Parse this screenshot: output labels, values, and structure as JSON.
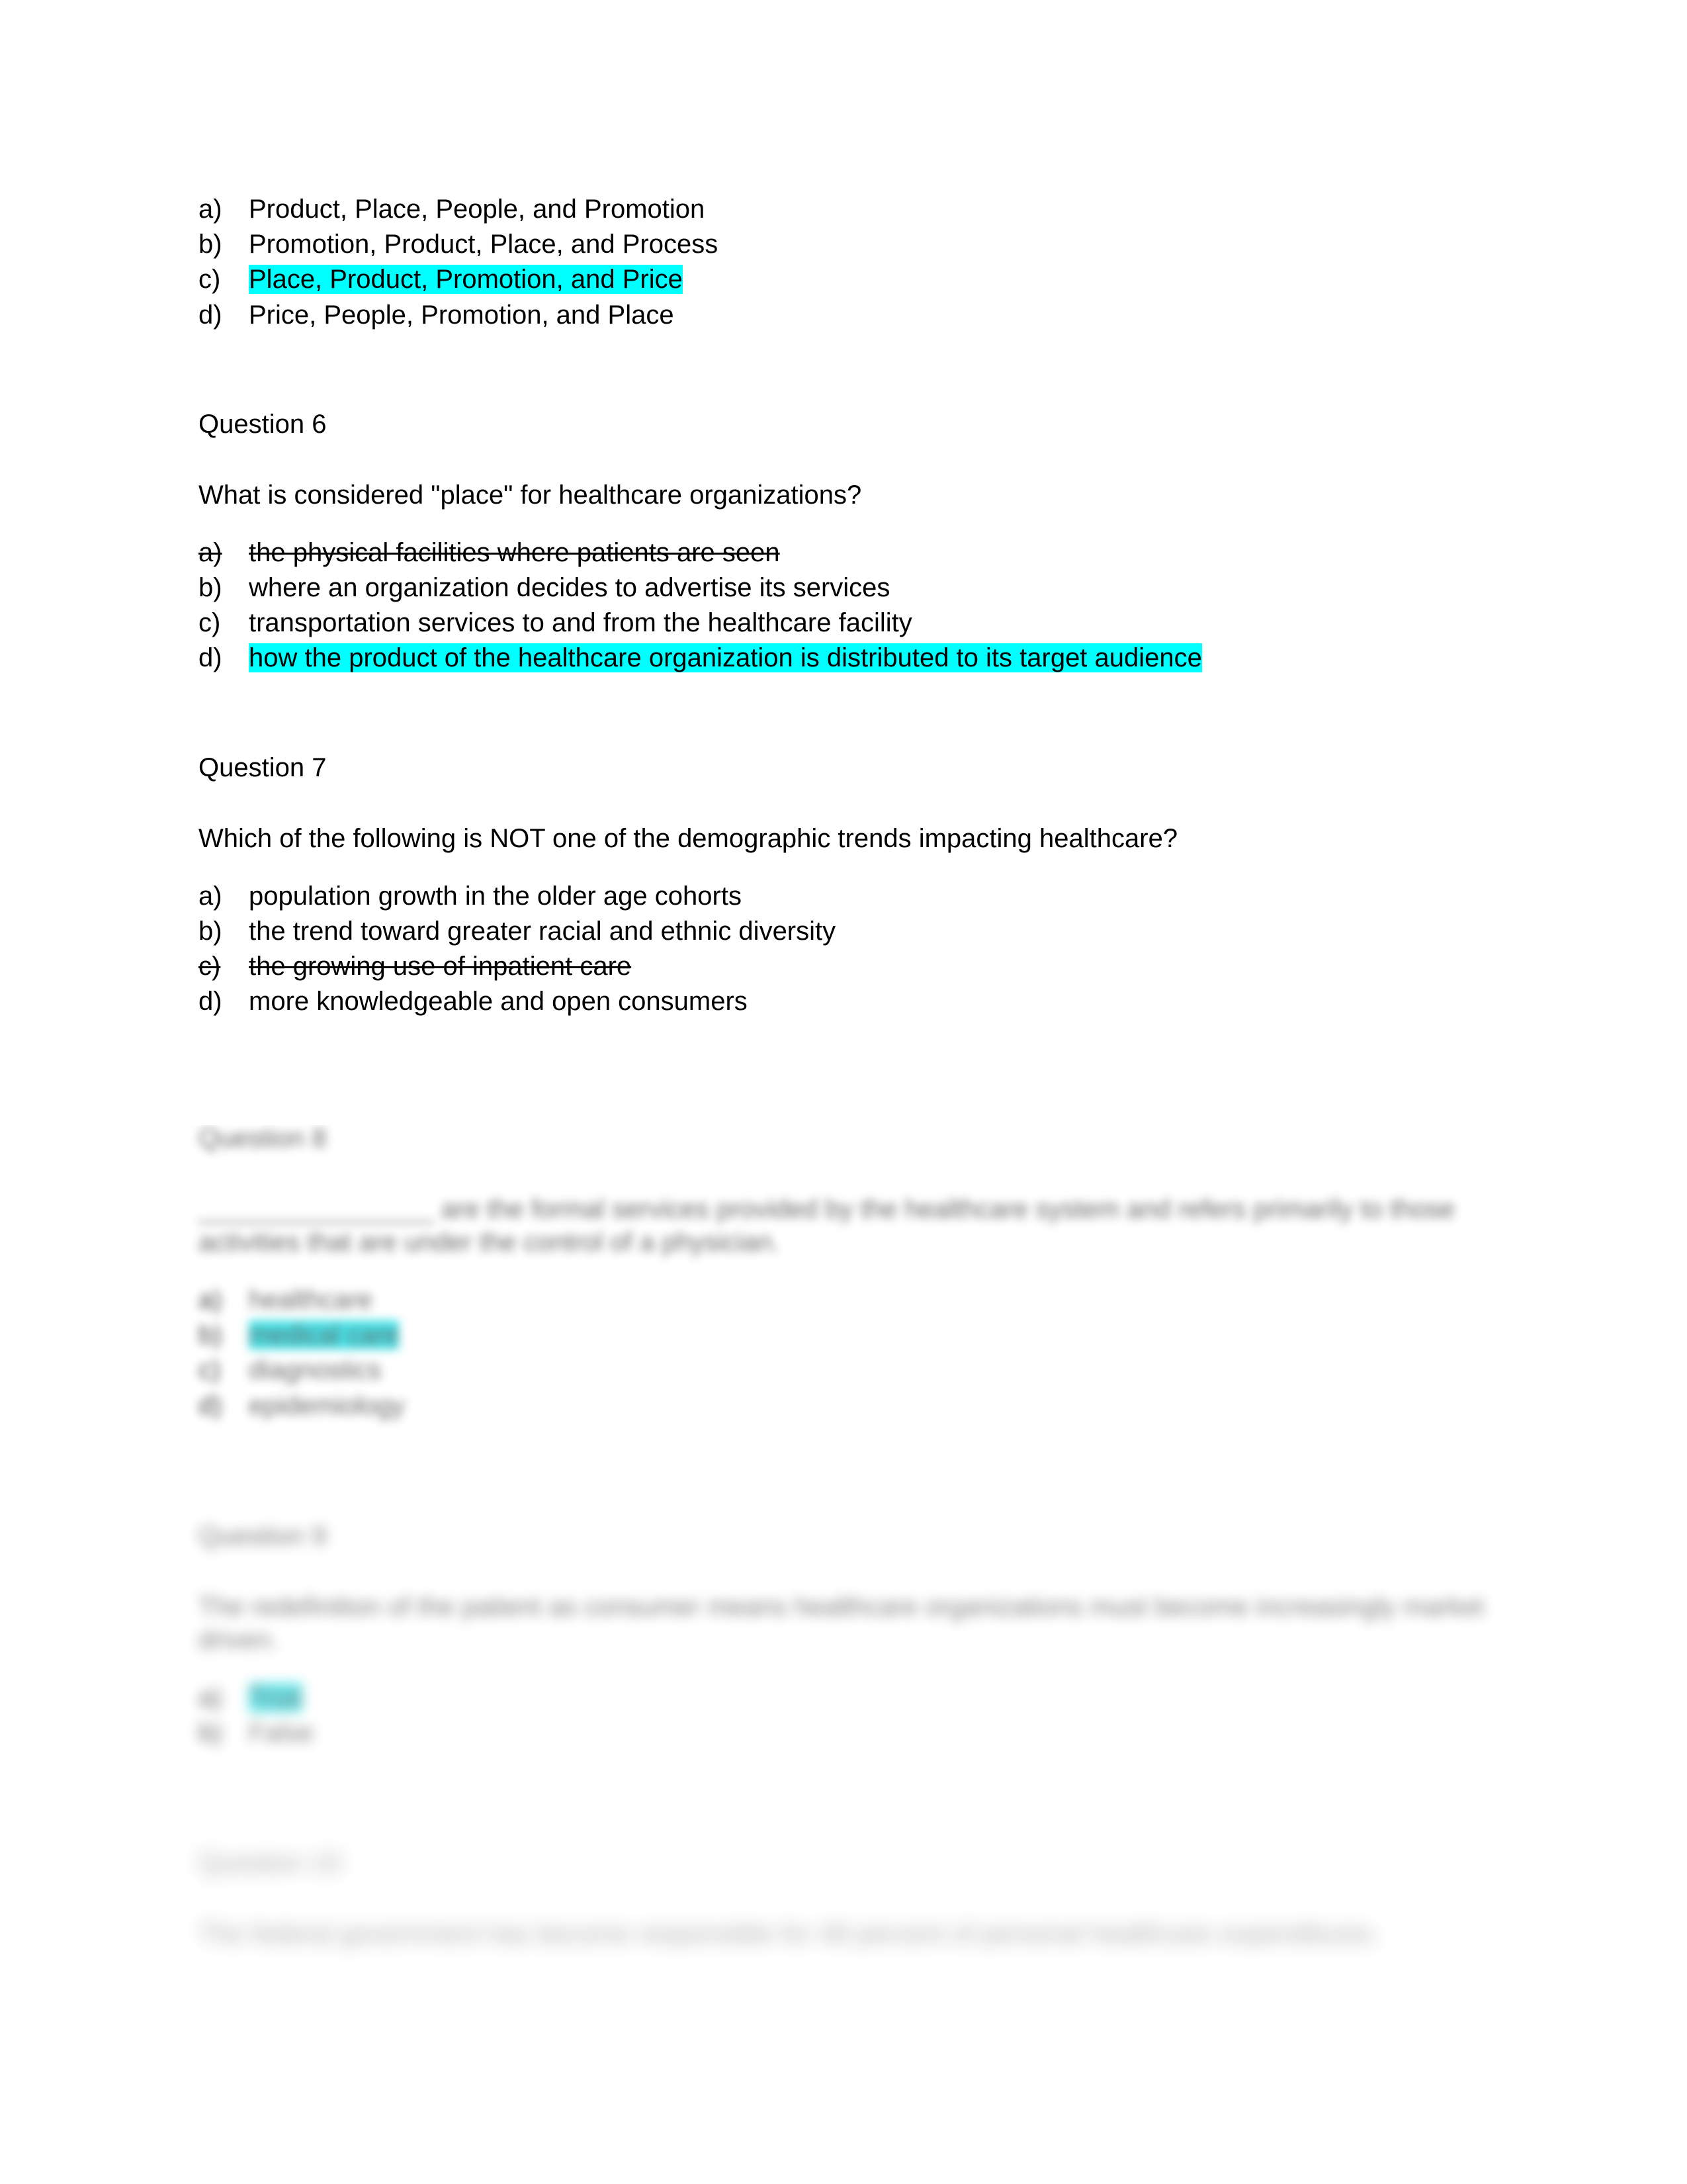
{
  "document": {
    "highlight_color": "#00ffff",
    "text_color": "#000000",
    "background_color": "#ffffff"
  },
  "question_5_answers": {
    "options": [
      {
        "marker": "a)",
        "text": "Product, Place, People, and Promotion",
        "highlighted": false,
        "struck": false
      },
      {
        "marker": "b)",
        "text": "Promotion, Product, Place, and Process",
        "highlighted": false,
        "struck": false
      },
      {
        "marker": "c)",
        "text": "Place, Product, Promotion, and Price",
        "highlighted": true,
        "struck": false
      },
      {
        "marker": "d)",
        "text": "Price, People, Promotion, and Place",
        "highlighted": false,
        "struck": false
      }
    ]
  },
  "question_6": {
    "heading": "Question 6",
    "stem": "What is considered \"place\" for healthcare organizations?",
    "options": [
      {
        "marker": "a)",
        "text": "the physical facilities where patients are seen",
        "highlighted": false,
        "struck": true
      },
      {
        "marker": "b)",
        "text": "where an organization decides to advertise its services",
        "highlighted": false,
        "struck": false
      },
      {
        "marker": "c)",
        "text": "transportation services to and from the healthcare facility",
        "highlighted": false,
        "struck": false
      },
      {
        "marker": "d)",
        "text": "how the product of the healthcare organization is distributed to its target audience",
        "highlighted": true,
        "struck": false
      }
    ]
  },
  "question_7": {
    "heading": "Question 7",
    "stem": "Which of the following is NOT one of the demographic trends impacting healthcare?",
    "options": [
      {
        "marker": "a)",
        "text": "population growth in the older age cohorts",
        "highlighted": false,
        "struck": false
      },
      {
        "marker": "b)",
        "text": "the trend toward greater racial and ethnic diversity",
        "highlighted": false,
        "struck": false
      },
      {
        "marker": "c)",
        "text": "the growing use of inpatient care",
        "highlighted": false,
        "struck": true
      },
      {
        "marker": "d)",
        "text": "more knowledgeable and open consumers",
        "highlighted": false,
        "struck": false
      }
    ]
  },
  "question_8": {
    "heading": "Question 8",
    "stem": "________________ are the formal services provided by the healthcare system and refers primarily to those activities that are under the control of a physician.",
    "options": [
      {
        "marker": "a)",
        "text": "healthcare",
        "highlighted": false,
        "struck": false
      },
      {
        "marker": "b)",
        "text": "medical care",
        "highlighted": true,
        "struck": false
      },
      {
        "marker": "c)",
        "text": "diagnostics",
        "highlighted": false,
        "struck": false
      },
      {
        "marker": "d)",
        "text": "epidemiology",
        "highlighted": false,
        "struck": false
      }
    ]
  },
  "question_9": {
    "heading": "Question 9",
    "stem": "The redefinition of the patient as consumer means healthcare organizations must become increasingly market driven.",
    "options": [
      {
        "marker": "a)",
        "text": "True",
        "highlighted": true,
        "struck": false
      },
      {
        "marker": "b)",
        "text": "False",
        "highlighted": false,
        "struck": false
      }
    ]
  },
  "question_10": {
    "heading": "Question 10",
    "stem": "The federal government has become responsible for 48 percent of personal healthcare expenditures."
  }
}
